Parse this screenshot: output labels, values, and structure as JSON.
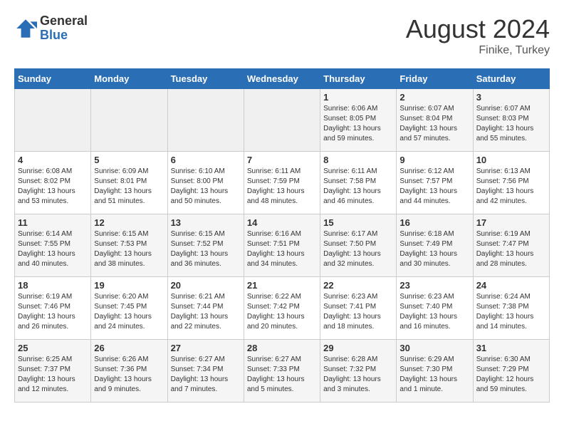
{
  "logo": {
    "general": "General",
    "blue": "Blue"
  },
  "header": {
    "month": "August 2024",
    "location": "Finike, Turkey"
  },
  "weekdays": [
    "Sunday",
    "Monday",
    "Tuesday",
    "Wednesday",
    "Thursday",
    "Friday",
    "Saturday"
  ],
  "weeks": [
    [
      {
        "day": "",
        "content": ""
      },
      {
        "day": "",
        "content": ""
      },
      {
        "day": "",
        "content": ""
      },
      {
        "day": "",
        "content": ""
      },
      {
        "day": "1",
        "content": "Sunrise: 6:06 AM\nSunset: 8:05 PM\nDaylight: 13 hours\nand 59 minutes."
      },
      {
        "day": "2",
        "content": "Sunrise: 6:07 AM\nSunset: 8:04 PM\nDaylight: 13 hours\nand 57 minutes."
      },
      {
        "day": "3",
        "content": "Sunrise: 6:07 AM\nSunset: 8:03 PM\nDaylight: 13 hours\nand 55 minutes."
      }
    ],
    [
      {
        "day": "4",
        "content": "Sunrise: 6:08 AM\nSunset: 8:02 PM\nDaylight: 13 hours\nand 53 minutes."
      },
      {
        "day": "5",
        "content": "Sunrise: 6:09 AM\nSunset: 8:01 PM\nDaylight: 13 hours\nand 51 minutes."
      },
      {
        "day": "6",
        "content": "Sunrise: 6:10 AM\nSunset: 8:00 PM\nDaylight: 13 hours\nand 50 minutes."
      },
      {
        "day": "7",
        "content": "Sunrise: 6:11 AM\nSunset: 7:59 PM\nDaylight: 13 hours\nand 48 minutes."
      },
      {
        "day": "8",
        "content": "Sunrise: 6:11 AM\nSunset: 7:58 PM\nDaylight: 13 hours\nand 46 minutes."
      },
      {
        "day": "9",
        "content": "Sunrise: 6:12 AM\nSunset: 7:57 PM\nDaylight: 13 hours\nand 44 minutes."
      },
      {
        "day": "10",
        "content": "Sunrise: 6:13 AM\nSunset: 7:56 PM\nDaylight: 13 hours\nand 42 minutes."
      }
    ],
    [
      {
        "day": "11",
        "content": "Sunrise: 6:14 AM\nSunset: 7:55 PM\nDaylight: 13 hours\nand 40 minutes."
      },
      {
        "day": "12",
        "content": "Sunrise: 6:15 AM\nSunset: 7:53 PM\nDaylight: 13 hours\nand 38 minutes."
      },
      {
        "day": "13",
        "content": "Sunrise: 6:15 AM\nSunset: 7:52 PM\nDaylight: 13 hours\nand 36 minutes."
      },
      {
        "day": "14",
        "content": "Sunrise: 6:16 AM\nSunset: 7:51 PM\nDaylight: 13 hours\nand 34 minutes."
      },
      {
        "day": "15",
        "content": "Sunrise: 6:17 AM\nSunset: 7:50 PM\nDaylight: 13 hours\nand 32 minutes."
      },
      {
        "day": "16",
        "content": "Sunrise: 6:18 AM\nSunset: 7:49 PM\nDaylight: 13 hours\nand 30 minutes."
      },
      {
        "day": "17",
        "content": "Sunrise: 6:19 AM\nSunset: 7:47 PM\nDaylight: 13 hours\nand 28 minutes."
      }
    ],
    [
      {
        "day": "18",
        "content": "Sunrise: 6:19 AM\nSunset: 7:46 PM\nDaylight: 13 hours\nand 26 minutes."
      },
      {
        "day": "19",
        "content": "Sunrise: 6:20 AM\nSunset: 7:45 PM\nDaylight: 13 hours\nand 24 minutes."
      },
      {
        "day": "20",
        "content": "Sunrise: 6:21 AM\nSunset: 7:44 PM\nDaylight: 13 hours\nand 22 minutes."
      },
      {
        "day": "21",
        "content": "Sunrise: 6:22 AM\nSunset: 7:42 PM\nDaylight: 13 hours\nand 20 minutes."
      },
      {
        "day": "22",
        "content": "Sunrise: 6:23 AM\nSunset: 7:41 PM\nDaylight: 13 hours\nand 18 minutes."
      },
      {
        "day": "23",
        "content": "Sunrise: 6:23 AM\nSunset: 7:40 PM\nDaylight: 13 hours\nand 16 minutes."
      },
      {
        "day": "24",
        "content": "Sunrise: 6:24 AM\nSunset: 7:38 PM\nDaylight: 13 hours\nand 14 minutes."
      }
    ],
    [
      {
        "day": "25",
        "content": "Sunrise: 6:25 AM\nSunset: 7:37 PM\nDaylight: 13 hours\nand 12 minutes."
      },
      {
        "day": "26",
        "content": "Sunrise: 6:26 AM\nSunset: 7:36 PM\nDaylight: 13 hours\nand 9 minutes."
      },
      {
        "day": "27",
        "content": "Sunrise: 6:27 AM\nSunset: 7:34 PM\nDaylight: 13 hours\nand 7 minutes."
      },
      {
        "day": "28",
        "content": "Sunrise: 6:27 AM\nSunset: 7:33 PM\nDaylight: 13 hours\nand 5 minutes."
      },
      {
        "day": "29",
        "content": "Sunrise: 6:28 AM\nSunset: 7:32 PM\nDaylight: 13 hours\nand 3 minutes."
      },
      {
        "day": "30",
        "content": "Sunrise: 6:29 AM\nSunset: 7:30 PM\nDaylight: 13 hours\nand 1 minute."
      },
      {
        "day": "31",
        "content": "Sunrise: 6:30 AM\nSunset: 7:29 PM\nDaylight: 12 hours\nand 59 minutes."
      }
    ]
  ]
}
